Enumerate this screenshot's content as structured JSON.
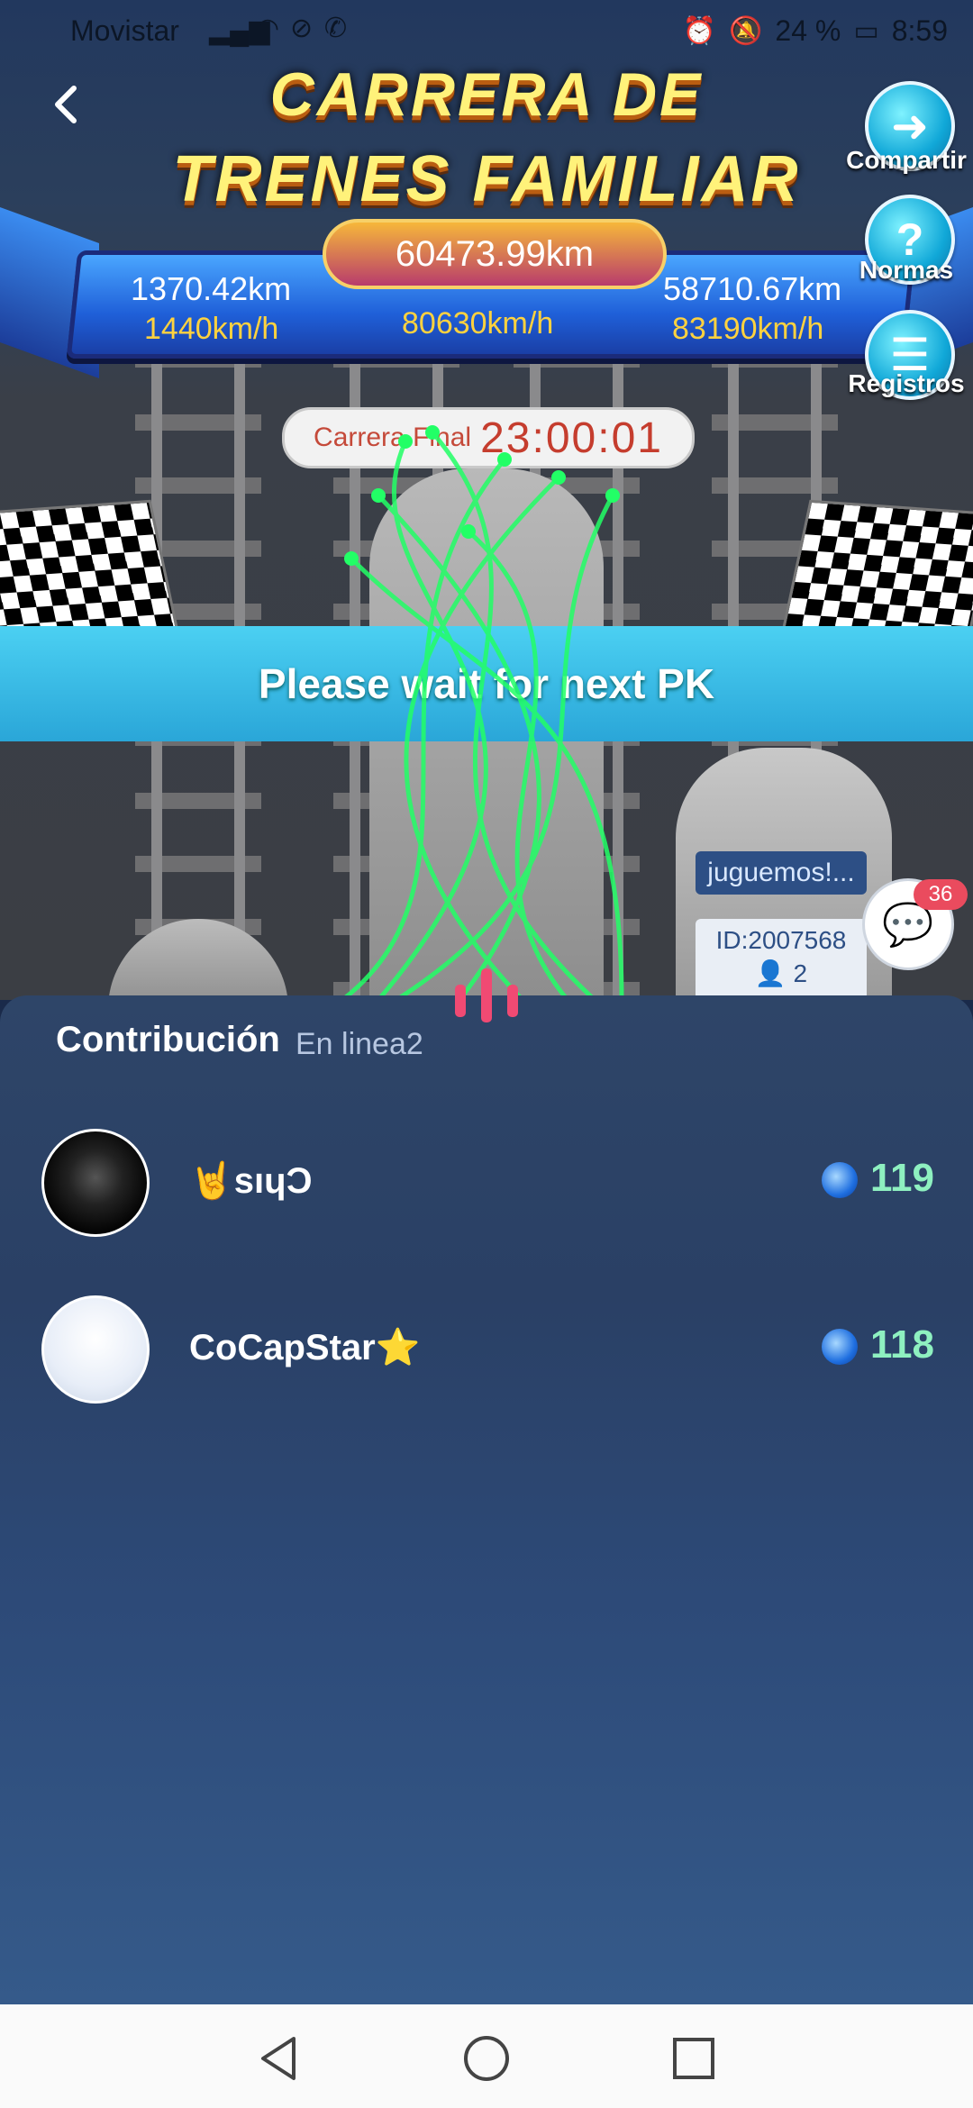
{
  "status_bar": {
    "carrier": "Movistar",
    "battery": "24 %",
    "time": "8:59",
    "icons": [
      "signal-icon",
      "wifi-icon",
      "blocked-icon",
      "whatsapp-icon",
      "alarm-icon",
      "mute-icon",
      "battery-icon"
    ]
  },
  "game": {
    "title_line1": "CARRERA DE",
    "title_line2": "TRENES FAMILIAR",
    "total_distance": "60473.99km",
    "left_distance": "1370.42km",
    "left_speed": "1440km/h",
    "center_speed": "80630km/h",
    "right_distance": "58710.67km",
    "right_speed": "83190km/h",
    "countdown_label": "Carrera Final",
    "countdown_time": "23:00:01",
    "banner": "Please wait for next PK",
    "train_name": "juguemos!...",
    "train_id": "ID:2007568",
    "train_members": "2"
  },
  "side_buttons": {
    "share": "Compartir",
    "rules": "Normas",
    "records": "Registros"
  },
  "chat": {
    "badge": "36"
  },
  "contribution": {
    "title": "Contribución",
    "online": "En linea2",
    "rows": [
      {
        "name": "🤘sıɥƆ",
        "score": "119"
      },
      {
        "name": "CoCapStar⭐",
        "score": "118"
      }
    ]
  },
  "colors": {
    "title_yellow": "#fff27a",
    "speed_yellow": "#ffd23f",
    "score_green": "#8ef0c0",
    "banner_blue": "#2aa6d8",
    "glow_green": "#22ff66"
  }
}
